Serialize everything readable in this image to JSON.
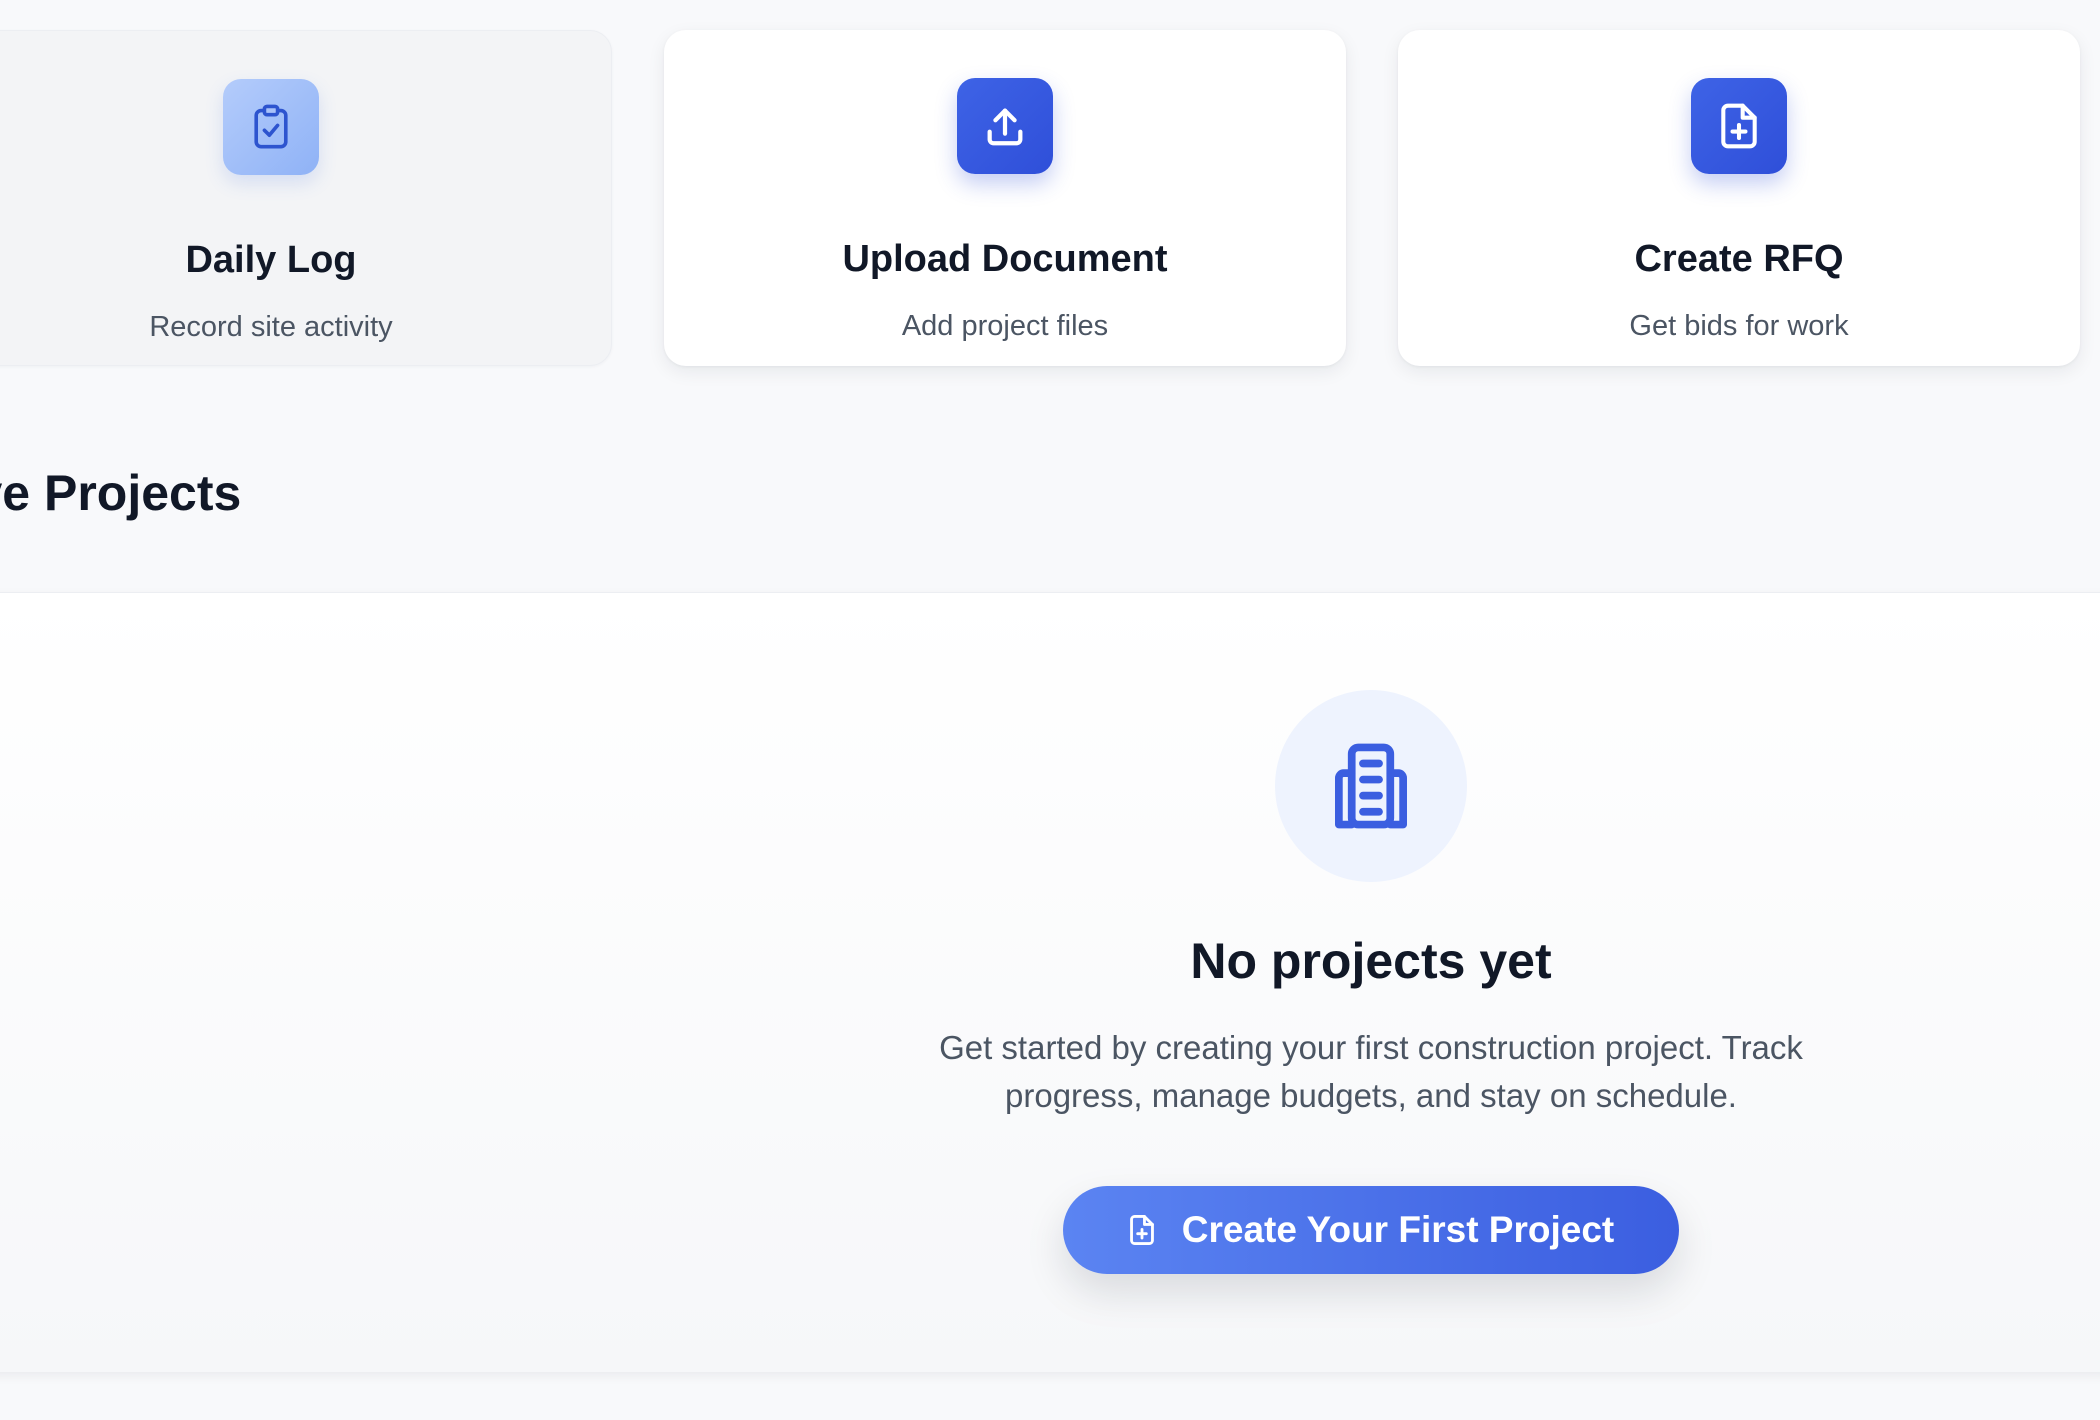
{
  "quick_actions": [
    {
      "title": "Daily Log",
      "subtitle": "Record site activity",
      "icon": "clipboard-check-icon"
    },
    {
      "title": "Upload Document",
      "subtitle": "Add project files",
      "icon": "upload-icon"
    },
    {
      "title": "Create RFQ",
      "subtitle": "Get bids for work",
      "icon": "file-plus-icon"
    }
  ],
  "projects": {
    "section_title": "Active Projects",
    "empty_state": {
      "icon": "building-icon",
      "title": "No projects yet",
      "description": "Get started by creating your first construction project. Track progress, manage budgets, and stay on schedule.",
      "cta_label": "Create Your First Project",
      "cta_icon": "file-plus-icon"
    }
  },
  "colors": {
    "accent": "#3b5ee0",
    "accent_light": "#5b84f2",
    "icon_soft_bg": "#eef3fe",
    "text_primary": "#111827",
    "text_secondary": "#4b5563",
    "page_bg": "#f8f9fb"
  }
}
